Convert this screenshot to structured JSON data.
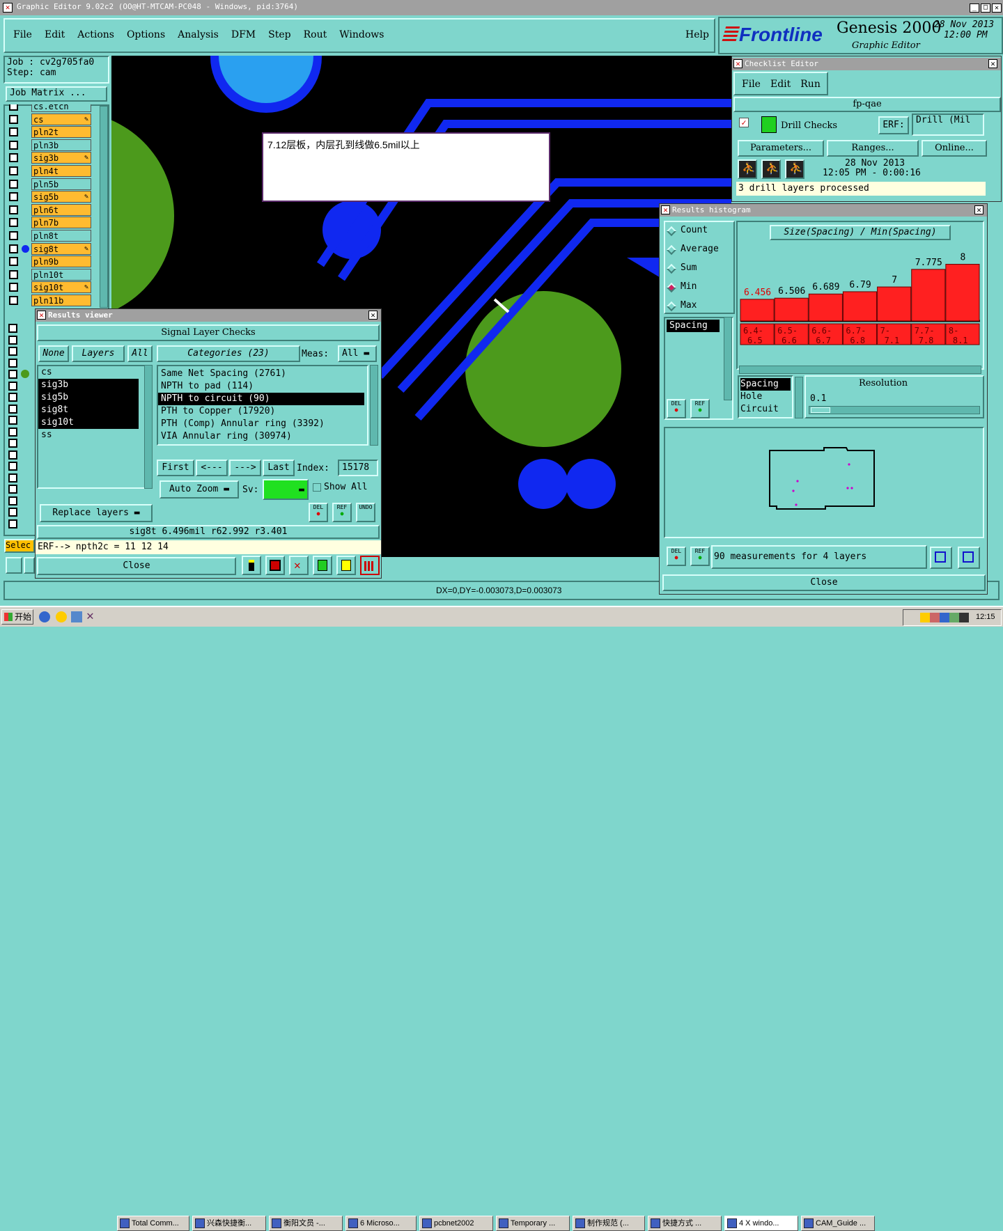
{
  "window": {
    "title": "Graphic Editor 9.02c2 (OO@HT-MTCAM-PC048 - Windows, pid:3764)"
  },
  "menubar": {
    "items": [
      "File",
      "Edit",
      "Actions",
      "Options",
      "Analysis",
      "DFM",
      "Step",
      "Rout",
      "Windows"
    ],
    "help": "Help"
  },
  "brand": {
    "logo": "Frontline",
    "product": "Genesis 2000",
    "subtitle": "Graphic Editor",
    "date": "28 Nov 2013",
    "time": "12:00 PM"
  },
  "job": {
    "job": "Job : cv2g705fa0",
    "step": "Step: cam",
    "matrix_button": "Job Matrix ..."
  },
  "layers": [
    {
      "name": "cs.etch",
      "active": false
    },
    {
      "name": "cs",
      "active": true,
      "pair": true
    },
    {
      "name": "pln2t",
      "active": true
    },
    {
      "name": "pln3b",
      "active": false
    },
    {
      "name": "sig3b",
      "active": true,
      "pair": true
    },
    {
      "name": "pln4t",
      "active": true
    },
    {
      "name": "pln5b",
      "active": false
    },
    {
      "name": "sig5b",
      "active": true,
      "pair": true
    },
    {
      "name": "pln6t",
      "active": true
    },
    {
      "name": "pln7b",
      "active": true
    },
    {
      "name": "pln8t",
      "active": false
    },
    {
      "name": "sig8t",
      "active": true,
      "pair": true
    },
    {
      "name": "pln9b",
      "active": true
    },
    {
      "name": "pln10t",
      "active": false
    },
    {
      "name": "sig10t",
      "active": true,
      "pair": true
    },
    {
      "name": "pln11b",
      "active": true
    }
  ],
  "sel_label": "Selec",
  "note": {
    "text": "7.12层板，内层孔到线做6.5mil以上"
  },
  "status_bar": {
    "text": "DX=0,DY=-0.003073,D=0.003073"
  },
  "results_viewer": {
    "title": "Results viewer",
    "header": "Signal Layer Checks",
    "none": "None",
    "layers": "Layers",
    "all": "All",
    "layer_list": [
      "cs",
      "sig3b",
      "sig5b",
      "sig8t",
      "sig10t",
      "ss"
    ],
    "categories_btn": "Categories (23)",
    "meas_label": "Meas:",
    "meas_value": "All",
    "categories": [
      "Same Net Spacing (2761)",
      "NPTH to pad (114)",
      "NPTH to circuit (90)",
      "PTH to Copper (17920)",
      "PTH (Comp) Annular ring (3392)",
      "VIA Annular ring (30974)"
    ],
    "first": "First",
    "prev": "<---",
    "next": "--->",
    "last": "Last",
    "index_label": "Index:",
    "index_value": "15178",
    "auto_zoom": "Auto Zoom",
    "sv_label": "Sv:",
    "show_all": "Show All",
    "replace_layers": "Replace layers",
    "del": "DEL",
    "ref": "REF",
    "undo": "UNDO",
    "info": "sig8t 6.496mil  r62.992  r3.401",
    "erf": "ERF--> npth2c = 11 12 14",
    "close": "Close"
  },
  "checklist": {
    "title": "Checklist Editor",
    "menu": [
      "File",
      "Edit",
      "Run"
    ],
    "name": "fp-qae",
    "item": "Drill Checks",
    "erf_label": "ERF:",
    "erf_value": "Drill (Mil",
    "parameters": "Parameters...",
    "ranges": "Ranges...",
    "online": "Online...",
    "date": "28 Nov 2013",
    "time": "12:05 PM - 0:00:16",
    "status": "3 drill layers processed"
  },
  "histogram": {
    "title": "Results histogram",
    "options": [
      "Count",
      "Average",
      "Sum",
      "Min",
      "Max"
    ],
    "selected": "Min",
    "chart_title": "Size(Spacing) / Min(Spacing)",
    "value_list": [
      "Spacing"
    ],
    "categories_list": [
      "Spacing",
      "Hole",
      "Circuit"
    ],
    "resolution_label": "Resolution",
    "resolution_value": "0.1",
    "del": "DEL",
    "ref": "REF",
    "summary": "90 measurements for 4 layers",
    "close": "Close"
  },
  "chart_data": {
    "type": "bar",
    "title": "Size(Spacing) / Min(Spacing)",
    "categories": [
      "6.4-6.5",
      "6.5-6.6",
      "6.6-6.7",
      "6.7-6.8",
      "7-7.1",
      "7.7-7.8",
      "8-8.1"
    ],
    "values": [
      6.456,
      6.506,
      6.689,
      6.79,
      7,
      7.775,
      8
    ],
    "value_labels": [
      "6.456",
      "6.506",
      "6.689",
      "6.79",
      "7",
      "7.775",
      "8"
    ],
    "bar_color": "#ff2020"
  },
  "taskbar": {
    "start": "开始",
    "tasks": [
      "Total Comm...",
      "兴森快捷衡...",
      "衡阳文员 -...",
      "6 Microso...",
      "pcbnet2002",
      "Temporary ...",
      "制作规范 (...",
      "快捷方式 ...",
      "4 X windo...",
      "CAM_Guide ..."
    ],
    "clock": "12:15"
  }
}
